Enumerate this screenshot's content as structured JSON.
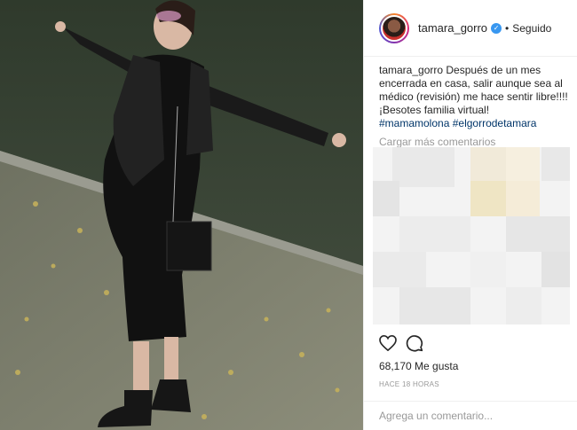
{
  "header": {
    "username": "tamara_gorro",
    "verified_icon": "verified-badge-icon",
    "separator": "•",
    "follow_label": "Seguido"
  },
  "caption": {
    "username": "tamara_gorro",
    "text": "Después de un mes encerrada en casa, salir aunque sea al médico (revisión) me hace sentir libre!!!! ¡Besotes familia virtual!",
    "hashtags": [
      "#mamamolona",
      "#elgorrodetamara"
    ]
  },
  "load_more_label": "Cargar más comentarios",
  "actions": {
    "like_icon": "heart-icon",
    "comment_icon": "comment-icon",
    "likes_count": "68,170",
    "likes_label": "Me gusta",
    "time_label": "HACE 18 HORAS"
  },
  "comment_placeholder": "Agrega un comentario..."
}
